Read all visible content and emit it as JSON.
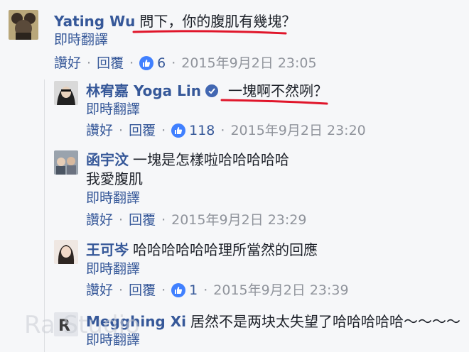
{
  "comments": [
    {
      "author": "Yating Wu",
      "text": "問下，你的腹肌有幾塊？",
      "translate": "即時翻譯",
      "like": "讚好",
      "reply": "回覆",
      "like_count": "6",
      "timestamp": "2015年9月2日 23:05"
    },
    {
      "author": "林宥嘉 Yoga Lin",
      "text": "一塊啊不然咧？",
      "translate": "即時翻譯",
      "like": "讚好",
      "reply": "回覆",
      "like_count": "118",
      "timestamp": "2015年9月2日 23:20"
    },
    {
      "author": "函宇汶",
      "text": "一塊是怎樣啦哈哈哈哈哈",
      "second_line": "我愛腹肌",
      "translate": "即時翻譯",
      "like": "讚好",
      "reply": "回覆",
      "timestamp": "2015年9月2日 23:29"
    },
    {
      "author": "王可岑",
      "text": "哈哈哈哈哈哈理所當然的回應",
      "translate": "即時翻譯",
      "like": "讚好",
      "reply": "回覆",
      "like_count": "1",
      "timestamp": "2015年9月2日 23:39"
    },
    {
      "author": "Megghing Xi",
      "text": "居然不是两块太失望了哈哈哈哈哈～～～～",
      "translate": "即時翻譯"
    }
  ],
  "colors": {
    "author": "#365899",
    "like_badge": "#4080ff",
    "underline": "#e0162b",
    "timestamp": "#90949c"
  },
  "watermark": "Ra Studio"
}
